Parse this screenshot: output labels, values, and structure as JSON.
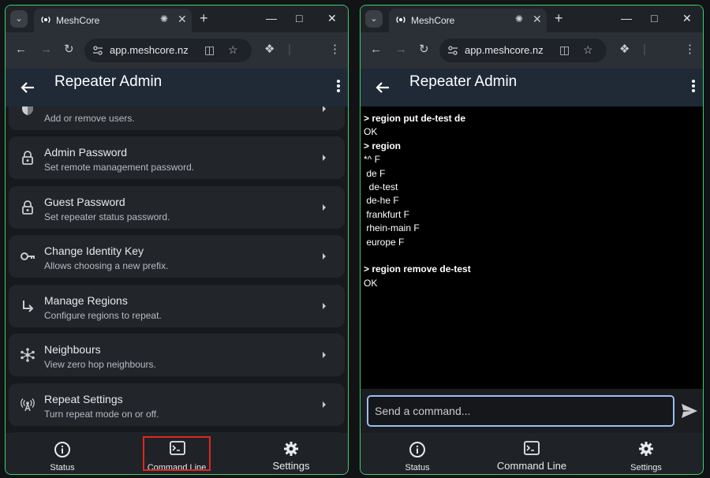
{
  "left": {
    "tab": {
      "title": "MeshCore"
    },
    "url": "app.meshcore.nz",
    "app_title": "Repeater Admin",
    "items": [
      {
        "title": "",
        "subtitle": "Add or remove users.",
        "icon": "shield-icon"
      },
      {
        "title": "Admin Password",
        "subtitle": "Set remote management password.",
        "icon": "lock-icon"
      },
      {
        "title": "Guest Password",
        "subtitle": "Set repeater status password.",
        "icon": "lock-icon"
      },
      {
        "title": "Change Identity Key",
        "subtitle": "Allows choosing a new prefix.",
        "icon": "key-icon"
      },
      {
        "title": "Manage Regions",
        "subtitle": "Configure regions to repeat.",
        "icon": "subdirectory-arrow-icon"
      },
      {
        "title": "Neighbours",
        "subtitle": "View zero hop neighbours.",
        "icon": "hub-icon"
      },
      {
        "title": "Repeat Settings",
        "subtitle": "Turn repeat mode on or off.",
        "icon": "antenna-icon"
      }
    ],
    "nav": {
      "status": "Status",
      "command_line": "Command Line",
      "settings": "Settings"
    },
    "highlight_color": "#e0261e"
  },
  "right": {
    "tab": {
      "title": "MeshCore"
    },
    "url": "app.meshcore.nz",
    "app_title": "Repeater Admin",
    "terminal": [
      {
        "text": "> region put de-test de",
        "kind": "cmd"
      },
      {
        "text": "OK",
        "kind": "out"
      },
      {
        "text": "> region",
        "kind": "cmd"
      },
      {
        "text": "*^ F",
        "kind": "out"
      },
      {
        "text": " de F",
        "kind": "out"
      },
      {
        "text": "  de-test",
        "kind": "out"
      },
      {
        "text": " de-he F",
        "kind": "out"
      },
      {
        "text": " frankfurt F",
        "kind": "out"
      },
      {
        "text": " rhein-main F",
        "kind": "out"
      },
      {
        "text": " europe F",
        "kind": "out"
      },
      {
        "text": "",
        "kind": "out"
      },
      {
        "text": "> region remove de-test",
        "kind": "cmd"
      },
      {
        "text": "OK",
        "kind": "out"
      }
    ],
    "input_placeholder": "Send a command...",
    "nav": {
      "status": "Status",
      "command_line": "Command Line",
      "settings": "Settings"
    }
  },
  "colors": {
    "window_border": "#3fcf6a",
    "app_bar": "#1f2a36",
    "input_border": "#9bbef2"
  }
}
